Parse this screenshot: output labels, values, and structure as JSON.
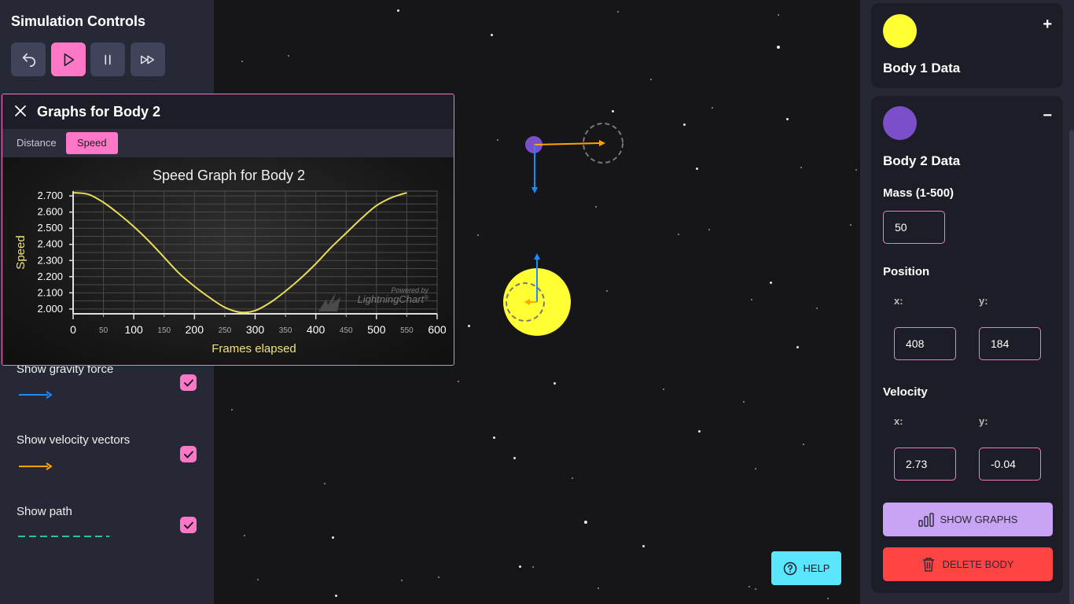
{
  "left": {
    "title": "Simulation Controls",
    "controls": [
      {
        "name": "undo-icon",
        "active": false
      },
      {
        "name": "play-icon",
        "active": true
      },
      {
        "name": "pause-icon",
        "active": false
      },
      {
        "name": "fast-forward-icon",
        "active": false
      }
    ],
    "toggles": [
      {
        "label": "Show gravity force",
        "checked": true,
        "legend_color": "#1a8cff",
        "legend_style": "arrow"
      },
      {
        "label": "Show velocity vectors",
        "checked": true,
        "legend_color": "#ffa500",
        "legend_style": "arrow"
      },
      {
        "label": "Show path",
        "checked": true,
        "legend_color": "#1ec9a0",
        "legend_style": "dashed"
      }
    ]
  },
  "graph_window": {
    "title": "Graphs for Body 2",
    "tabs": [
      "Distance",
      "Speed"
    ],
    "active_tab": "Speed",
    "watermark_top": "Powered by",
    "watermark_brand": "LightningChart",
    "watermark_suffix": "®"
  },
  "chart_data": {
    "type": "line",
    "title": "Speed Graph for Body 2",
    "xlabel": "Frames elapsed",
    "ylabel": "Speed",
    "xlim": [
      0,
      600
    ],
    "ylim": [
      1.97,
      2.73
    ],
    "x_major_ticks": [
      "0",
      "100",
      "200",
      "300",
      "400",
      "500",
      "600"
    ],
    "x_minor_ticks": [
      "50",
      "150",
      "250",
      "350",
      "450",
      "550"
    ],
    "y_ticks": [
      "2.000",
      "2.100",
      "2.200",
      "2.300",
      "2.400",
      "2.500",
      "2.600",
      "2.700"
    ],
    "grid": true,
    "series": [
      {
        "color": "#e6dc5a",
        "x": [
          0,
          25,
          50,
          75,
          100,
          125,
          150,
          175,
          200,
          225,
          250,
          275,
          300,
          325,
          350,
          375,
          400,
          425,
          450,
          475,
          500,
          525,
          550
        ],
        "y": [
          2.72,
          2.71,
          2.66,
          2.59,
          2.51,
          2.42,
          2.32,
          2.22,
          2.14,
          2.07,
          2.01,
          1.98,
          1.99,
          2.04,
          2.11,
          2.19,
          2.28,
          2.38,
          2.47,
          2.56,
          2.64,
          2.69,
          2.72
        ]
      }
    ]
  },
  "help": {
    "label": "HELP"
  },
  "right": {
    "body1": {
      "title": "Body 1 Data",
      "color": "#ffff33",
      "toggle": "+"
    },
    "body2": {
      "title": "Body 2 Data",
      "color": "#7b4fc9",
      "toggle": "−",
      "mass_label": "Mass (1-500)",
      "mass": "50",
      "position_label": "Position",
      "pos_x": "408",
      "pos_y": "184",
      "velocity_label": "Velocity",
      "vel_x": "2.73",
      "vel_y": "-0.04",
      "x_label": "x:",
      "y_label": "y:",
      "show_graphs": "SHOW GRAPHS",
      "delete_body": "DELETE BODY",
      "show_graphs_color": "#c9a4f5",
      "delete_color": "#ff4444"
    }
  }
}
